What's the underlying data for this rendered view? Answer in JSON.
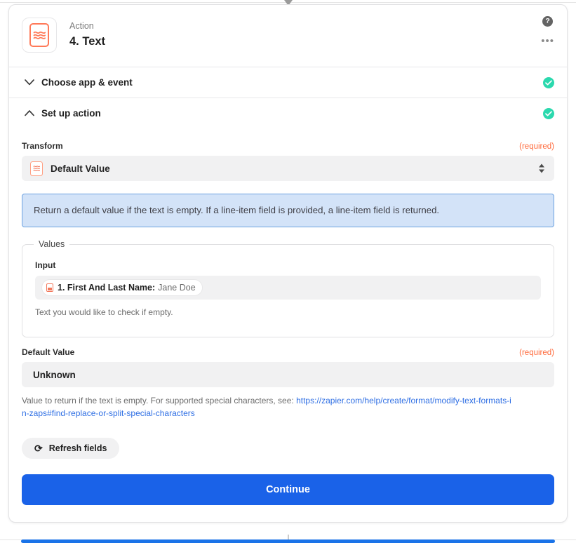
{
  "header": {
    "kicker": "Action",
    "title": "4. Text",
    "app_icon": "formatter-text-icon",
    "help_icon_glyph": "?",
    "more_menu_glyph": "•••"
  },
  "sections": [
    {
      "label": "Choose app & event",
      "expanded": false,
      "chevron": "chevron-down-icon",
      "status": "complete"
    },
    {
      "label": "Set up action",
      "expanded": true,
      "chevron": "chevron-up-icon",
      "status": "complete"
    }
  ],
  "setup": {
    "transform": {
      "label": "Transform",
      "required_tag": "(required)",
      "value": "Default Value",
      "icon": "formatter-text-mini-icon"
    },
    "callout": {
      "text": "Return a default value if the text is empty. If a line-item field is provided, a line-item field is returned."
    },
    "values_group": {
      "legend": "Values",
      "input": {
        "label": "Input",
        "token": {
          "icon": "trigger-step-icon",
          "key": "1. First And Last Name:",
          "value": "Jane Doe"
        },
        "help": "Text you would like to check if empty."
      }
    },
    "default_value": {
      "label": "Default Value",
      "required_tag": "(required)",
      "value": "Unknown",
      "help_prefix": "Value to return if the text is empty. For supported special characters, see: ",
      "help_link": "https://zapier.com/help/create/format/modify-text-formats-in-zaps#find-replace-or-split-special-characters"
    },
    "refresh_button": {
      "label": "Refresh fields",
      "icon": "refresh-icon",
      "glyph": "⟳"
    },
    "continue_button": {
      "label": "Continue"
    }
  },
  "colors": {
    "accent_orange": "#ff7a59",
    "primary_blue": "#1a62e8",
    "link_blue": "#2f6fe4",
    "success_green": "#2bd9ae",
    "required_orange": "#ff6b3d",
    "callout_bg": "#d3e3f8",
    "callout_border": "#6ca2e0",
    "field_bg": "#f1f1f2"
  }
}
